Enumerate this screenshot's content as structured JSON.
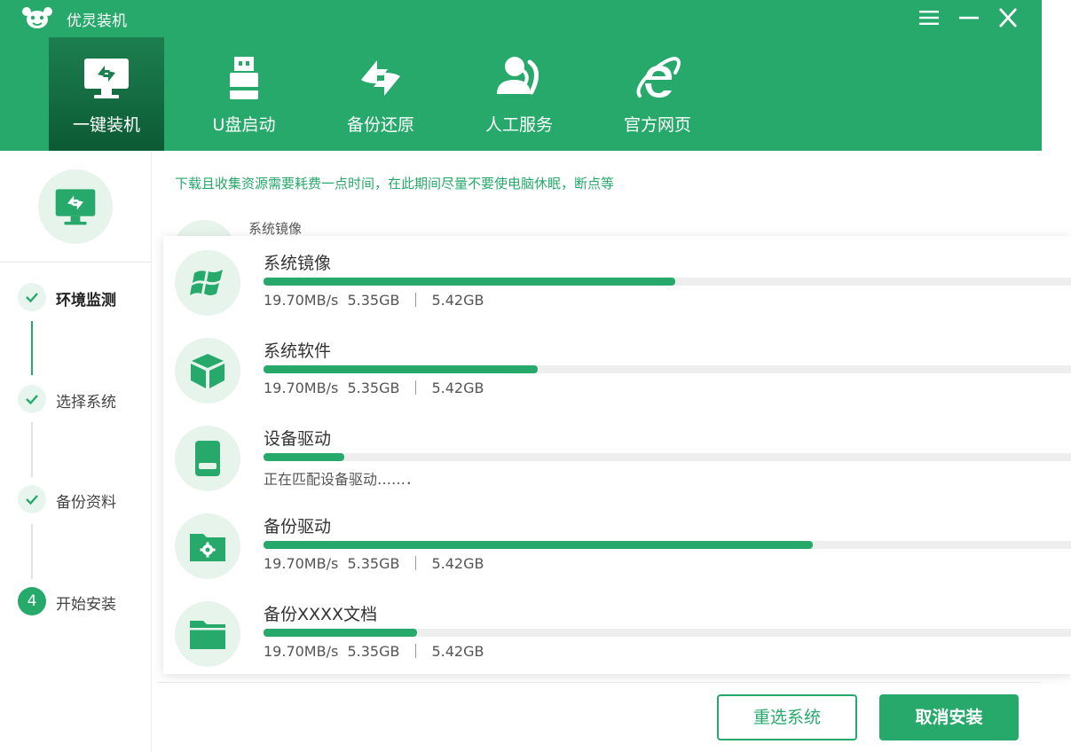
{
  "app": {
    "title": "优灵装机"
  },
  "nav": {
    "items": [
      {
        "label": "一键装机",
        "icon": "monitor-reinstall-icon"
      },
      {
        "label": "U盘启动",
        "icon": "usb-drive-icon"
      },
      {
        "label": "备份还原",
        "icon": "backup-restore-icon"
      },
      {
        "label": "人工服务",
        "icon": "customer-service-icon"
      },
      {
        "label": "官方网页",
        "icon": "ie-browser-icon"
      }
    ]
  },
  "window_controls": {
    "menu": "menu-icon",
    "minimize": "minimize-icon",
    "close": "close-icon"
  },
  "steps": [
    {
      "label": "环境监测",
      "state": "done"
    },
    {
      "label": "选择系统",
      "state": "done"
    },
    {
      "label": "备份资料",
      "state": "done"
    },
    {
      "label": "开始安装",
      "state": "current",
      "number": "4"
    }
  ],
  "hint": "下载且收集资源需要耗费一点时间，在此期间尽量不要使电脑休眠，断点等",
  "behind_label": "系统镜像",
  "downloads": [
    {
      "title": "系统镜像",
      "progress": 0.51,
      "speed": "19.70MB/s",
      "done": "5.35GB",
      "total": "5.42GB",
      "icon": "windows-logo-icon"
    },
    {
      "title": "系统软件",
      "progress": 0.34,
      "speed": "19.70MB/s",
      "done": "5.35GB",
      "total": "5.42GB",
      "icon": "package-box-icon"
    },
    {
      "title": "设备驱动",
      "progress": 0.1,
      "status": "正在匹配设备驱动……．",
      "icon": "hard-drive-icon"
    },
    {
      "title": "备份驱动",
      "progress": 0.68,
      "speed": "19.70MB/s",
      "done": "5.35GB",
      "total": "5.42GB",
      "icon": "folder-gear-icon"
    },
    {
      "title": "备份XXXX文档",
      "progress": 0.19,
      "speed": "19.70MB/s",
      "done": "5.35GB",
      "total": "5.42GB",
      "icon": "folder-icon"
    }
  ],
  "buttons": {
    "reselect": "重选系统",
    "cancel": "取消安装"
  },
  "colors": {
    "brand": "#27a96b",
    "brand_dark": "#0c5a34",
    "track": "#eeeeee",
    "icon_bg": "#e7f4ec"
  }
}
